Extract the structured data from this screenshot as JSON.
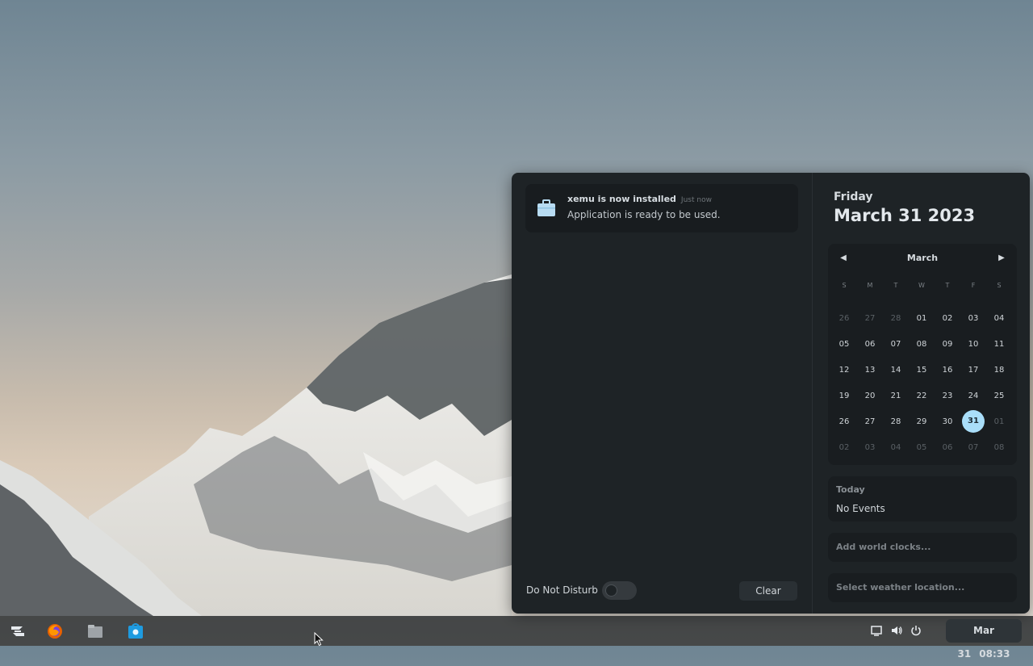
{
  "notification": {
    "title": "xemu is now installed",
    "time": "Just now",
    "body": "Application is ready to be used."
  },
  "footer": {
    "dnd_label": "Do Not Disturb",
    "dnd_on": false,
    "clear_label": "Clear"
  },
  "calendar": {
    "weekday": "Friday",
    "full_date": "March 31 2023",
    "month": "March",
    "weekdays": [
      "S",
      "M",
      "T",
      "W",
      "T",
      "F",
      "S"
    ],
    "weeks": [
      [
        "26",
        "27",
        "28",
        "01",
        "02",
        "03",
        "04"
      ],
      [
        "05",
        "06",
        "07",
        "08",
        "09",
        "10",
        "11"
      ],
      [
        "12",
        "13",
        "14",
        "15",
        "16",
        "17",
        "18"
      ],
      [
        "19",
        "20",
        "21",
        "22",
        "23",
        "24",
        "25"
      ],
      [
        "26",
        "27",
        "28",
        "29",
        "30",
        "31",
        "01"
      ],
      [
        "02",
        "03",
        "04",
        "05",
        "06",
        "07",
        "08"
      ]
    ],
    "today": "31",
    "accent": "#a9def9"
  },
  "events": {
    "heading": "Today",
    "empty": "No Events"
  },
  "world_clocks": {
    "label": "Add world clocks..."
  },
  "weather": {
    "label": "Select weather location..."
  },
  "taskbar": {
    "apps": [
      "zorin-menu-icon",
      "firefox-icon",
      "files-icon",
      "software-store-icon"
    ],
    "clock_date": "Mar 31",
    "clock_time": "08:33"
  }
}
